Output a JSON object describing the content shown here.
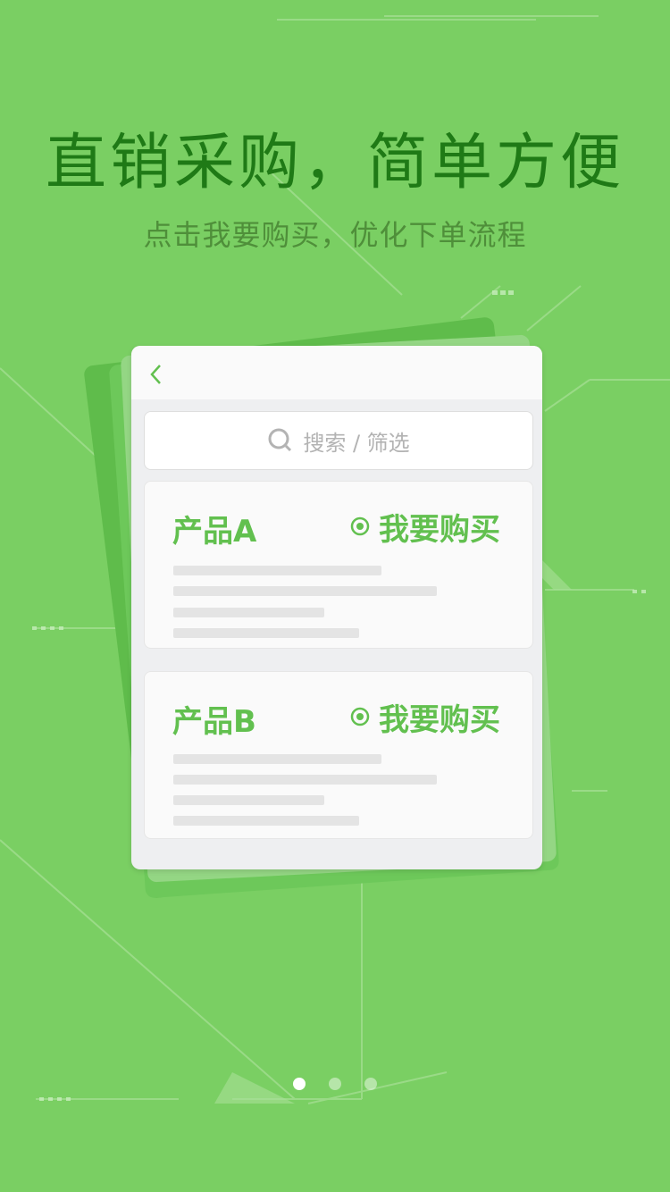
{
  "colors": {
    "background": "#7acf63",
    "accent": "#62c04f",
    "title": "#1f7a16"
  },
  "hero": {
    "title": "直销采购，简单方便",
    "subtitle": "点击我要购买，优化下单流程"
  },
  "card": {
    "back_icon": "chevron-left-icon",
    "search": {
      "icon": "search-icon",
      "placeholder": "搜索 / 筛选"
    },
    "products": [
      {
        "name": "产品A",
        "action_label": "我要购买",
        "action_icon": "radio-selected-icon"
      },
      {
        "name": "产品B",
        "action_label": "我要购买",
        "action_icon": "radio-selected-icon"
      }
    ]
  },
  "pager": {
    "count": 3,
    "active_index": 0
  }
}
